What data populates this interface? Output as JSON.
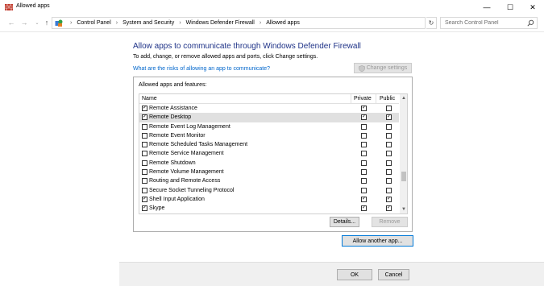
{
  "window": {
    "title": "Allowed apps",
    "minimize_glyph": "—",
    "maximize_glyph": "☐",
    "close_glyph": "✕"
  },
  "address_bar": {
    "crumbs": [
      "Control Panel",
      "System and Security",
      "Windows Defender Firewall",
      "Allowed apps"
    ],
    "separator": "›",
    "search_placeholder": "Search Control Panel"
  },
  "content": {
    "heading": "Allow apps to communicate through Windows Defender Firewall",
    "subtext": "To add, change, or remove allowed apps and ports, click Change settings.",
    "risk_link": "What are the risks of allowing an app to communicate?",
    "change_settings_label": "Change settings"
  },
  "apps_list": {
    "group_label": "Allowed apps and features:",
    "columns": {
      "name": "Name",
      "private": "Private",
      "public": "Public"
    },
    "rows": [
      {
        "name": "Remote Assistance",
        "enabled": true,
        "private": true,
        "public": false,
        "selected": false
      },
      {
        "name": "Remote Desktop",
        "enabled": true,
        "private": true,
        "public": true,
        "selected": true
      },
      {
        "name": "Remote Event Log Management",
        "enabled": false,
        "private": false,
        "public": false,
        "selected": false
      },
      {
        "name": "Remote Event Monitor",
        "enabled": false,
        "private": false,
        "public": false,
        "selected": false
      },
      {
        "name": "Remote Scheduled Tasks Management",
        "enabled": false,
        "private": false,
        "public": false,
        "selected": false
      },
      {
        "name": "Remote Service Management",
        "enabled": false,
        "private": false,
        "public": false,
        "selected": false
      },
      {
        "name": "Remote Shutdown",
        "enabled": false,
        "private": false,
        "public": false,
        "selected": false
      },
      {
        "name": "Remote Volume Management",
        "enabled": false,
        "private": false,
        "public": false,
        "selected": false
      },
      {
        "name": "Routing and Remote Access",
        "enabled": false,
        "private": false,
        "public": false,
        "selected": false
      },
      {
        "name": "Secure Socket Tunneling Protocol",
        "enabled": false,
        "private": false,
        "public": false,
        "selected": false
      },
      {
        "name": "Shell Input Application",
        "enabled": true,
        "private": true,
        "public": true,
        "selected": false
      },
      {
        "name": "Skype",
        "enabled": true,
        "private": true,
        "public": true,
        "selected": false
      }
    ],
    "details_label": "Details...",
    "remove_label": "Remove"
  },
  "allow_another_label": "Allow another app...",
  "footer": {
    "ok_label": "OK",
    "cancel_label": "Cancel"
  },
  "colors": {
    "heading": "#1e3287",
    "link": "#0066cc",
    "selection": "#e0e0e0",
    "focus_border": "#0078d7"
  }
}
